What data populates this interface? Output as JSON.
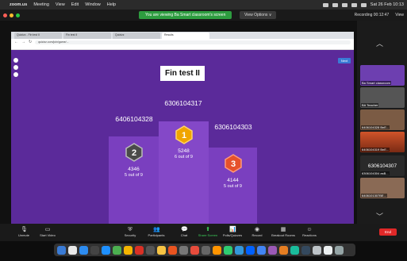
{
  "menubar": {
    "app": "zoom.us",
    "items": [
      "Meeting",
      "View",
      "Edit",
      "Window",
      "Help"
    ],
    "clock": "Sat 26 Feb 10:13"
  },
  "zoombar": {
    "banner": "You are viewing Ba Smart classroom's screen",
    "view_options": "View Options ∨",
    "recording": "Recording 00:12:47",
    "view": "View"
  },
  "browser": {
    "tabs": [
      "Quizizz - Fin test II",
      "Fin test II",
      "Quizizz",
      "Results"
    ],
    "url": "quizizz.com/join/game/..."
  },
  "quiz": {
    "title": "Fin test II",
    "next_label": "Next",
    "podium": [
      {
        "rank": "2",
        "id": "6406104328",
        "score": "4346",
        "result": "5 out of 9",
        "color": "#4a4a4a"
      },
      {
        "rank": "1",
        "id": "6306104317",
        "score": "5248",
        "result": "6 out of 9",
        "color": "#f0a500"
      },
      {
        "rank": "3",
        "id": "6306104303",
        "score": "4144",
        "result": "5 out of 9",
        "color": "#e6512b"
      }
    ]
  },
  "participants": {
    "tiles": [
      {
        "label": "Ba Smart classroom"
      },
      {
        "label": "BA Teacher"
      },
      {
        "label": "6406104328 BnE..."
      },
      {
        "label": "6406104319 BnE..."
      },
      {
        "label": "6306104307"
      },
      {
        "label": "6306104304 asB..."
      },
      {
        "label": "6406101307BE..."
      }
    ],
    "big_tile": "6306104304 snB..."
  },
  "toolbar": {
    "buttons": [
      "Unmute",
      "Start Video",
      "Security",
      "Participants",
      "Chat",
      "Share Screen",
      "Polls/Quizzes",
      "Record",
      "Breakout Rooms",
      "Reactions"
    ],
    "end": "End"
  }
}
